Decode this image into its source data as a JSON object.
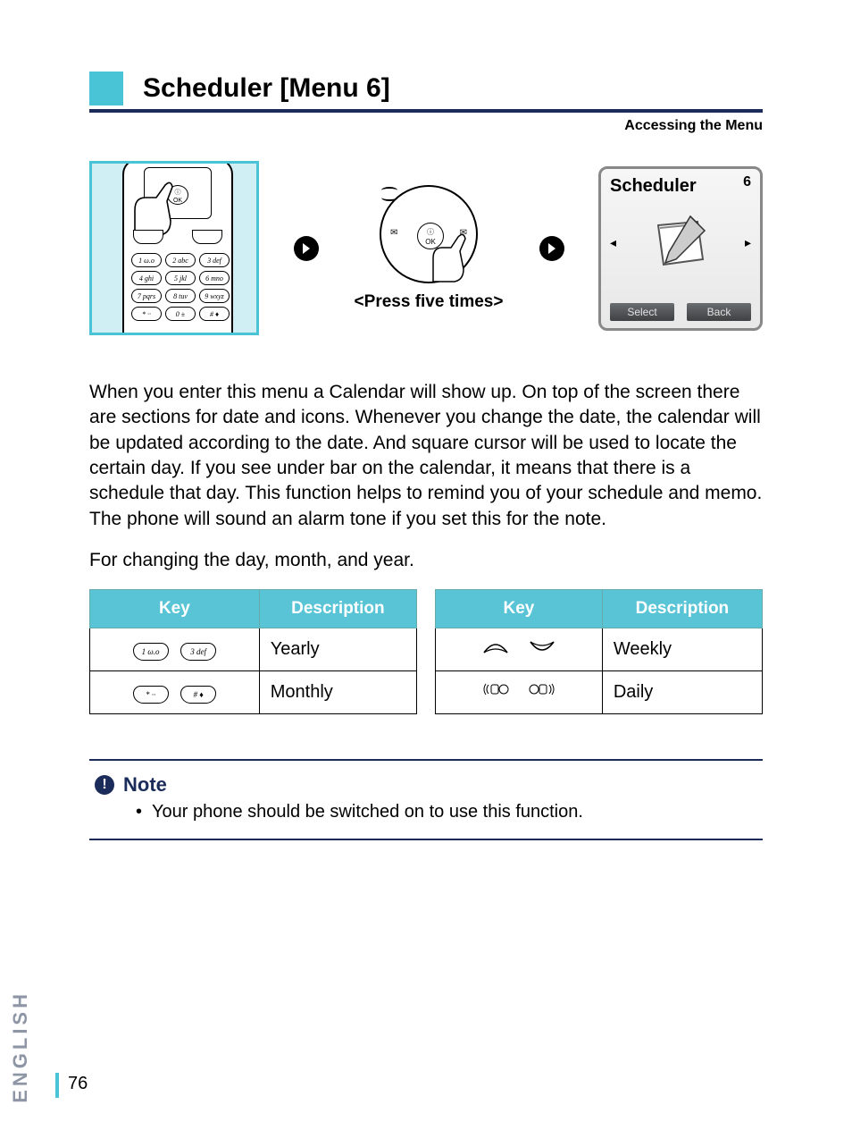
{
  "title": "Scheduler [Menu 6]",
  "subhead": "Accessing the Menu",
  "keypad": {
    "keys": [
      "1 ω.ο",
      "2 abc",
      "3 def",
      "4 ghi",
      "5 jkl",
      "6 mno",
      "7 pqrs",
      "8 tuv",
      "9 wxyz",
      "* ··",
      "0 ±",
      "# ♦"
    ],
    "ok_label": "ⓘ\nOK"
  },
  "nav": {
    "ok_label": "ⓘ\nOK",
    "left_glyph": "✉",
    "right_glyph": "✉",
    "caption": "<Press five times>"
  },
  "sched_screen": {
    "title": "Scheduler",
    "number": "6",
    "left_arrow": "◂",
    "right_arrow": "▸",
    "select_label": "Select",
    "back_label": "Back"
  },
  "body_para_1": "When you enter this menu a Calendar will show up. On top of the screen there are sections for date and icons. Whenever you change the date, the calendar will be updated according to the date. And square cursor will be used to locate the certain day. If you see under bar on the calendar, it means that there is a schedule that day. This function helps to remind you of your schedule and memo. The phone will sound an alarm tone if you set this for the note.",
  "body_para_2": "For changing the day, month, and year.",
  "table_headers": {
    "key": "Key",
    "desc": "Description"
  },
  "table_left": [
    {
      "keys": [
        "1 ω.ο",
        "3 def"
      ],
      "desc": "Yearly"
    },
    {
      "keys": [
        "* ··",
        "# ♦"
      ],
      "desc": "Monthly"
    }
  ],
  "table_right": [
    {
      "icon": "softup",
      "desc": "Weekly"
    },
    {
      "icon": "navlr",
      "desc": "Daily"
    }
  ],
  "note": {
    "label": "Note",
    "items": [
      "Your phone should be switched on to use this function."
    ]
  },
  "side_tab": "ENGLISH",
  "page_number": "76"
}
